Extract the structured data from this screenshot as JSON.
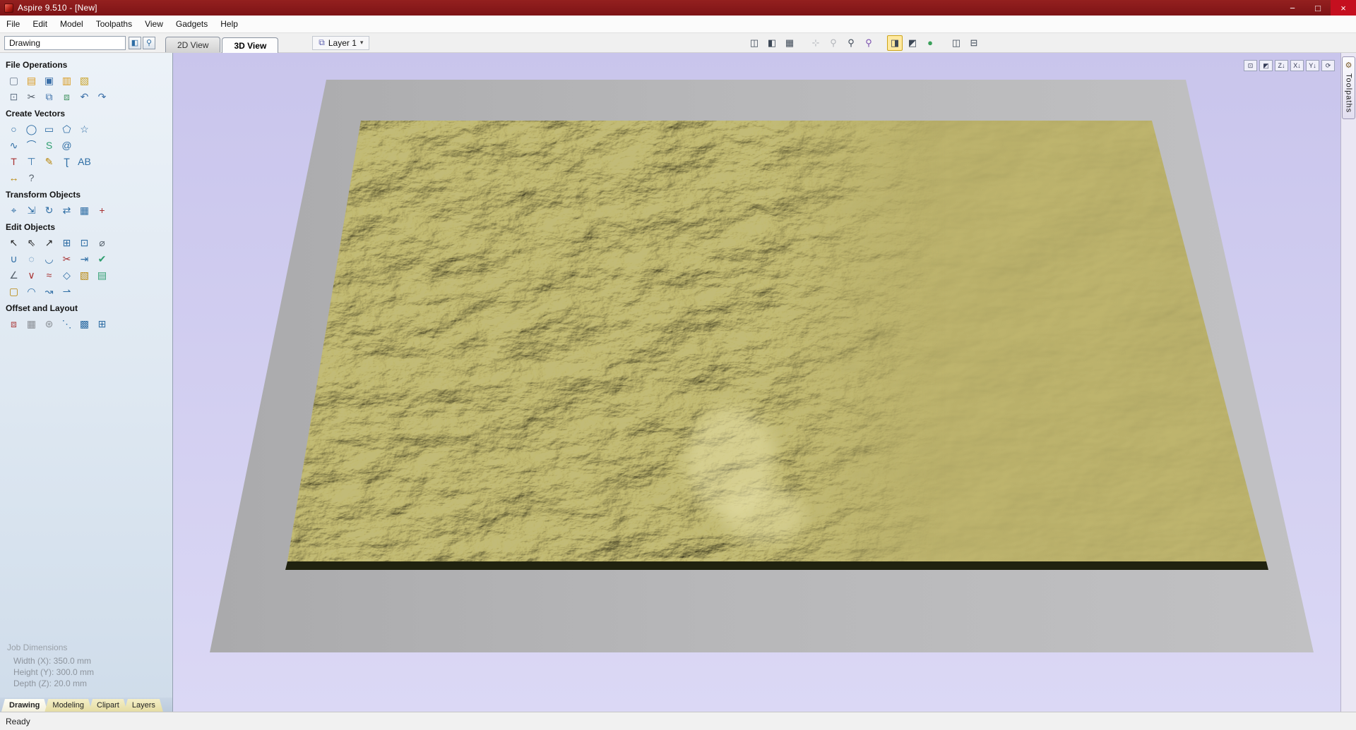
{
  "window": {
    "title": "Aspire 9.510 - [New]",
    "controls": [
      {
        "name": "minimize",
        "glyph": "−"
      },
      {
        "name": "maximize",
        "glyph": "□"
      },
      {
        "name": "close",
        "glyph": "×"
      }
    ]
  },
  "menu": {
    "items": [
      "File",
      "Edit",
      "Model",
      "Toolpaths",
      "View",
      "Gadgets",
      "Help"
    ]
  },
  "panel_selector": {
    "value": "Drawing",
    "buttons": [
      {
        "name": "dock-panel",
        "glyph": "◧"
      },
      {
        "name": "pin-panel",
        "glyph": "⚲"
      }
    ]
  },
  "view_tabs": [
    {
      "label": "2D View",
      "active": false
    },
    {
      "label": "3D View",
      "active": true
    }
  ],
  "layer_dropdown": {
    "icon_glyph": "⧉",
    "label": "Layer 1",
    "caret": "▾"
  },
  "view_toolbar": [
    {
      "name": "toggle-2d-3d-view",
      "glyph": "◫"
    },
    {
      "name": "split-view",
      "glyph": "◧"
    },
    {
      "name": "toggle-grid",
      "glyph": "▦"
    },
    {
      "name": "pan-view",
      "glyph": "⊹",
      "disabled": true,
      "sep": true
    },
    {
      "name": "zoom-out",
      "glyph": "⚲",
      "disabled": true
    },
    {
      "name": "zoom-window",
      "glyph": "⚲"
    },
    {
      "name": "zoom-to-selection",
      "glyph": "⚲",
      "color": "#7a4fae"
    },
    {
      "name": "toggle-shading",
      "glyph": "◨",
      "active": true,
      "sep": true
    },
    {
      "name": "toggle-wireframe",
      "glyph": "◩"
    },
    {
      "name": "toggle-material",
      "glyph": "●",
      "color": "#3aa05a"
    },
    {
      "name": "tile-windows-vertical",
      "glyph": "◫",
      "sep": true
    },
    {
      "name": "tile-windows-horizontal",
      "glyph": "⊟"
    }
  ],
  "view_controls": [
    {
      "name": "scale-to-fit",
      "glyph": "⊡"
    },
    {
      "name": "iso-view",
      "glyph": "◩"
    },
    {
      "name": "plan-view-z",
      "glyph": "Z↓"
    },
    {
      "name": "view-along-x",
      "glyph": "X↓"
    },
    {
      "name": "view-along-y",
      "glyph": "Y↓"
    },
    {
      "name": "rotate-view",
      "glyph": "⟳"
    }
  ],
  "sidebar": {
    "sections": [
      {
        "title": "File Operations",
        "rows": [
          [
            {
              "name": "new-file",
              "glyph": "▢",
              "color": "#6b7b8d"
            },
            {
              "name": "open-file",
              "glyph": "▤",
              "color": "#d99a1f"
            },
            {
              "name": "save-file",
              "glyph": "▣",
              "color": "#3a6fa8"
            },
            {
              "name": "import-vectors",
              "glyph": "▥",
              "color": "#d99a1f"
            },
            {
              "name": "export-vectors",
              "glyph": "▧",
              "color": "#c9a227"
            }
          ],
          [
            {
              "name": "select-all",
              "glyph": "⊡",
              "color": "#6b7b8d"
            },
            {
              "name": "cut",
              "glyph": "✂",
              "color": "#55606b"
            },
            {
              "name": "copy",
              "glyph": "⧉",
              "color": "#3a6fa8"
            },
            {
              "name": "paste",
              "glyph": "⧈",
              "color": "#3a8f5a"
            },
            {
              "name": "undo",
              "glyph": "↶",
              "color": "#3a6fa8"
            },
            {
              "name": "redo",
              "glyph": "↷",
              "color": "#3a6fa8"
            }
          ]
        ]
      },
      {
        "title": "Create Vectors",
        "rows": [
          [
            {
              "name": "draw-circle",
              "glyph": "○",
              "color": "#2e6da4"
            },
            {
              "name": "draw-ellipse",
              "glyph": "◯",
              "color": "#2e6da4"
            },
            {
              "name": "draw-rectangle",
              "glyph": "▭",
              "color": "#2e6da4"
            },
            {
              "name": "draw-polygon",
              "glyph": "⬠",
              "color": "#2e6da4"
            },
            {
              "name": "draw-star",
              "glyph": "☆",
              "color": "#2e6da4"
            }
          ],
          [
            {
              "name": "draw-polyline",
              "glyph": "∿",
              "color": "#2e6da4"
            },
            {
              "name": "draw-arc",
              "glyph": "⌒",
              "color": "#2e6da4"
            },
            {
              "name": "draw-curve",
              "glyph": "S",
              "color": "#2e9e6f"
            },
            {
              "name": "draw-spiral",
              "glyph": "@",
              "color": "#2e6da4"
            }
          ],
          [
            {
              "name": "draw-text",
              "glyph": "T",
              "color": "#a83232"
            },
            {
              "name": "text-in-box",
              "glyph": "⊤",
              "color": "#2e6da4"
            },
            {
              "name": "edit-text",
              "glyph": "✎",
              "color": "#b8860b"
            },
            {
              "name": "text-on-curve",
              "glyph": "Ʈ",
              "color": "#2e6da4"
            },
            {
              "name": "text-spacing",
              "glyph": "AB",
              "color": "#2e6da4"
            }
          ],
          [
            {
              "name": "draw-dimension",
              "glyph": "↔",
              "color": "#b8860b"
            },
            {
              "name": "quick-measure",
              "glyph": "?",
              "color": "#55606b"
            }
          ]
        ]
      },
      {
        "title": "Transform Objects",
        "rows": [
          [
            {
              "name": "move-selection",
              "glyph": "⌖",
              "color": "#2e6da4"
            },
            {
              "name": "set-size",
              "glyph": "⇲",
              "color": "#2e6da4"
            },
            {
              "name": "rotate-selection",
              "glyph": "↻",
              "color": "#2e6da4"
            },
            {
              "name": "mirror-selection",
              "glyph": "⇄",
              "color": "#2e6da4"
            },
            {
              "name": "align-objects",
              "glyph": "▦",
              "color": "#2e6da4"
            },
            {
              "name": "center-in-material",
              "glyph": "+",
              "color": "#a83232"
            }
          ]
        ]
      },
      {
        "title": "Edit Objects",
        "rows": [
          [
            {
              "name": "select-tool",
              "glyph": "↖",
              "color": "#222222"
            },
            {
              "name": "node-edit-tool",
              "glyph": "⇖",
              "color": "#222222"
            },
            {
              "name": "interactive-transform",
              "glyph": "↗",
              "color": "#222222"
            },
            {
              "name": "snap-grid",
              "glyph": "⊞",
              "color": "#2e6da4"
            },
            {
              "name": "guides",
              "glyph": "⊡",
              "color": "#2e6da4"
            },
            {
              "name": "measure-tool",
              "glyph": "⌀",
              "color": "#55606b"
            }
          ],
          [
            {
              "name": "join-vectors",
              "glyph": "∪",
              "color": "#2e6da4"
            },
            {
              "name": "close-vector",
              "glyph": "◌",
              "color": "#2e6da4"
            },
            {
              "name": "fillet-tool",
              "glyph": "◡",
              "color": "#2e6da4"
            },
            {
              "name": "trim-tool",
              "glyph": "✂",
              "color": "#a83232"
            },
            {
              "name": "extend-tool",
              "glyph": "⇥",
              "color": "#2e6da4"
            },
            {
              "name": "vector-validator",
              "glyph": "✔",
              "color": "#2e9e6f"
            }
          ],
          [
            {
              "name": "cut-vector",
              "glyph": "∠",
              "color": "#55606b"
            },
            {
              "name": "weld-vectors",
              "glyph": "∨",
              "color": "#a83232"
            },
            {
              "name": "smooth-vectors",
              "glyph": "≈",
              "color": "#a83232"
            },
            {
              "name": "warp-object",
              "glyph": "◇",
              "color": "#2e6da4"
            },
            {
              "name": "trace-bitmap",
              "glyph": "▧",
              "color": "#b8860b"
            },
            {
              "name": "edit-picture",
              "glyph": "▤",
              "color": "#2e9e6f"
            }
          ],
          [
            {
              "name": "round-corners",
              "glyph": "▢",
              "color": "#b8860b"
            },
            {
              "name": "fit-arc",
              "glyph": "◠",
              "color": "#2e6da4"
            },
            {
              "name": "stretch-curve",
              "glyph": "↝",
              "color": "#2e6da4"
            },
            {
              "name": "bend-curve",
              "glyph": "⇀",
              "color": "#2e6da4"
            }
          ]
        ]
      },
      {
        "title": "Offset and Layout",
        "rows": [
          [
            {
              "name": "offset-vectors",
              "glyph": "⧈",
              "color": "#a83232"
            },
            {
              "name": "array-copy",
              "glyph": "▦",
              "color": "#8a8f95"
            },
            {
              "name": "circular-array",
              "glyph": "⊛",
              "color": "#8a8f95"
            },
            {
              "name": "copy-along-path",
              "glyph": "⋱",
              "color": "#2e6da4"
            },
            {
              "name": "nesting",
              "glyph": "▩",
              "color": "#2e6da4"
            },
            {
              "name": "layout-grid",
              "glyph": "⊞",
              "color": "#2e6da4"
            }
          ]
        ]
      }
    ],
    "job_dimensions": {
      "title": "Job Dimensions",
      "lines": [
        "Width (X): 350.0 mm",
        "Height (Y): 300.0 mm",
        "Depth (Z): 20.0 mm"
      ]
    },
    "tabs": [
      {
        "label": "Drawing",
        "active": true
      },
      {
        "label": "Modeling",
        "active": false
      },
      {
        "label": "Clipart",
        "active": false
      },
      {
        "label": "Layers",
        "active": false
      }
    ]
  },
  "right_tab": {
    "label": "Toolpaths",
    "icon_glyph": "⚙"
  },
  "status_bar": {
    "text": "Ready"
  },
  "colors": {
    "titlebar": "#7d1316",
    "canvas_top": "#c9c5ec",
    "canvas_bottom": "#dbd8f5",
    "terrain_base": "#c6bf7e",
    "terrain_edge": "#20220f",
    "slab": "#b6b6b8",
    "active_icon_bg": "#ffe9a0"
  }
}
